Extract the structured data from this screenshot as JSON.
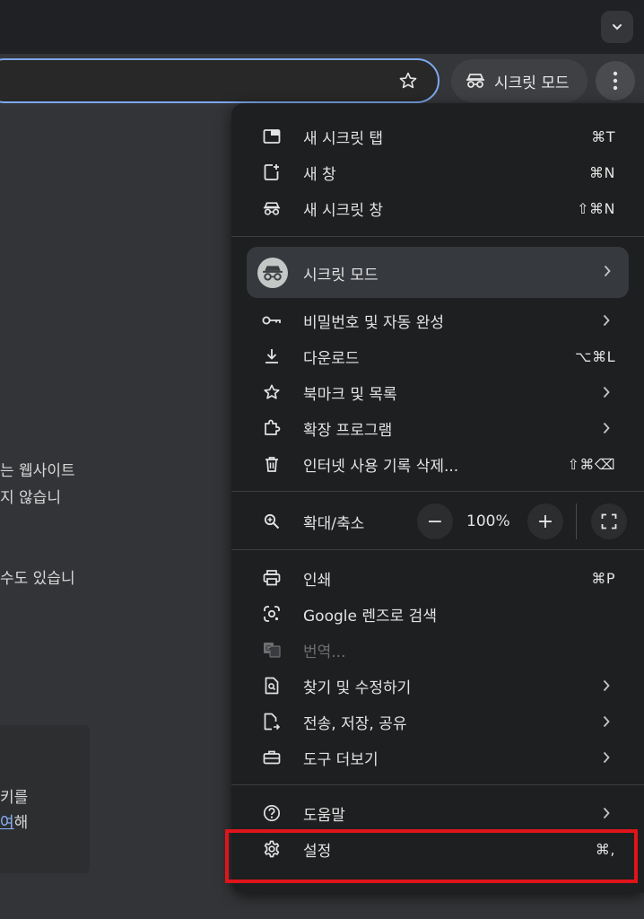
{
  "toolbar": {
    "incognito_chip_label": "시크릿 모드"
  },
  "background_page": {
    "lines": [
      "는 웹사이트",
      "지 않습니",
      "수도 있습니"
    ],
    "card_line1": "키를",
    "card_link": "여",
    "card_suffix": "해"
  },
  "menu": {
    "group1": [
      {
        "label": "새 시크릿 탭",
        "shortcut": "⌘T",
        "icon": "new-tab-icon"
      },
      {
        "label": "새 창",
        "shortcut": "⌘N",
        "icon": "new-window-icon"
      },
      {
        "label": "새 시크릿 창",
        "shortcut": "⇧⌘N",
        "icon": "incognito-icon"
      }
    ],
    "profile": {
      "label": "시크릿 모드",
      "icon": "incognito-avatar-icon"
    },
    "group2": [
      {
        "label": "비밀번호 및 자동 완성",
        "icon": "key-icon",
        "submenu": true
      },
      {
        "label": "다운로드",
        "shortcut": "⌥⌘L",
        "icon": "download-icon"
      },
      {
        "label": "북마크 및 목록",
        "icon": "star-icon",
        "submenu": true
      },
      {
        "label": "확장 프로그램",
        "icon": "extension-icon",
        "submenu": true
      },
      {
        "label": "인터넷 사용 기록 삭제...",
        "shortcut": "⇧⌘⌫",
        "icon": "trash-icon"
      }
    ],
    "zoom": {
      "label": "확대/축소",
      "value": "100%",
      "minus": "−",
      "plus": "+",
      "icon": "zoom-icon"
    },
    "group3": [
      {
        "label": "인쇄",
        "shortcut": "⌘P",
        "icon": "print-icon"
      },
      {
        "label": "Google 렌즈로 검색",
        "icon": "lens-icon"
      },
      {
        "label": "번역...",
        "icon": "translate-icon",
        "disabled": true
      },
      {
        "label": "찾기 및 수정하기",
        "icon": "find-icon",
        "submenu": true
      },
      {
        "label": "전송, 저장, 공유",
        "icon": "share-icon",
        "submenu": true
      },
      {
        "label": "도구 더보기",
        "icon": "toolbox-icon",
        "submenu": true
      }
    ],
    "group4": [
      {
        "label": "도움말",
        "icon": "help-icon",
        "submenu": true
      },
      {
        "label": "설정",
        "shortcut": "⌘,",
        "icon": "gear-icon"
      }
    ]
  },
  "colors": {
    "menu_bg": "#1e1f20",
    "highlight_box": "#e0141b",
    "omnibox_focus": "#7ca8ee"
  }
}
